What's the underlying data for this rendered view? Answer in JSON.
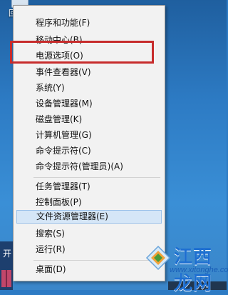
{
  "desktop": {
    "icon_label": "回收站"
  },
  "start_fragment": {
    "label": "开"
  },
  "menu": {
    "items": [
      {
        "label": "程序和功能(F)"
      },
      {
        "label": "移动中心(B)"
      },
      {
        "label": "电源选项(O)"
      },
      {
        "label": "事件查看器(V)"
      },
      {
        "label": "系统(Y)"
      },
      {
        "label": "设备管理器(M)"
      },
      {
        "label": "磁盘管理(K)"
      },
      {
        "label": "计算机管理(G)"
      },
      {
        "label": "命令提示符(C)"
      },
      {
        "label": "命令提示符(管理员)(A)"
      },
      {
        "label": "任务管理器(T)"
      },
      {
        "label": "控制面板(P)"
      },
      {
        "label": "文件资源管理器(E)"
      },
      {
        "label": "搜索(S)"
      },
      {
        "label": "运行(R)"
      },
      {
        "label": "桌面(D)"
      }
    ],
    "highlighted_item": "文件资源管理器(E)",
    "annotation_color": "#c72c2c",
    "highlight_color": "#d5e6f7"
  },
  "watermark": {
    "cn": "江西龙网",
    "url": "www.xitonghe.com"
  }
}
